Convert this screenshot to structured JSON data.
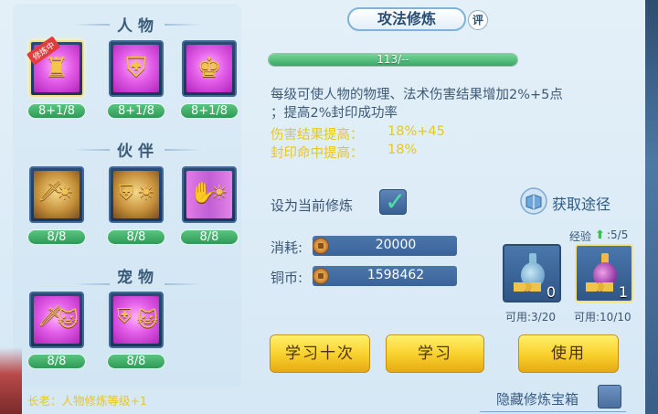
{
  "panel": {
    "tab_title": "攻法修炼",
    "review_badge": "评"
  },
  "sections": {
    "character": {
      "title": "人物",
      "slots": [
        {
          "icon": "golden-armor-icon",
          "level": "8+1/8",
          "badge": "修炼中",
          "active": true
        },
        {
          "icon": "golden-shield-armor-icon",
          "level": "8+1/8",
          "active": false
        },
        {
          "icon": "golden-warrior-armor-icon",
          "level": "8+1/8",
          "active": false
        }
      ]
    },
    "partner": {
      "title": "伙伴",
      "slots": [
        {
          "icon": "lion-sword-icon",
          "level": "8/8"
        },
        {
          "icon": "lion-shield-icon",
          "level": "8/8"
        },
        {
          "icon": "lion-claw-icon",
          "level": "8/8"
        }
      ]
    },
    "pet": {
      "title": "宠物",
      "slots": [
        {
          "icon": "lion-cub-sword-icon",
          "level": "8/8"
        },
        {
          "icon": "lion-cub-shield-icon",
          "level": "8/8"
        }
      ]
    }
  },
  "progress": {
    "text": "113/--",
    "fill_fraction": 1.0
  },
  "description": {
    "line1": "每级可使人物的物理、法术伤害结果增加2%+5点",
    "line2": "；提高2%封印成功率"
  },
  "bonuses": [
    {
      "label": "伤害结果提高：",
      "value": "18%+45"
    },
    {
      "label": "封印命中提高：",
      "value": "18%"
    }
  ],
  "set_current": {
    "label": "设为当前修炼",
    "checked": true
  },
  "obtain": {
    "label": "获取途径"
  },
  "costs": {
    "consume_label": "消耗:",
    "consume_value": "20000",
    "coin_label": "铜币:",
    "coin_value": "1598462"
  },
  "experience": {
    "label": "经验",
    "value": ":5/5"
  },
  "items": [
    {
      "icon": "blue-potion-icon",
      "count": "0",
      "usable": "可用:3/20",
      "selected": false
    },
    {
      "icon": "purple-potion-icon",
      "count": "1",
      "usable": "可用:10/10",
      "selected": true
    }
  ],
  "buttons": {
    "learn_ten": "学习十次",
    "learn": "学习",
    "use": "使用"
  },
  "hint": "长老：人物修炼等级+1",
  "hidden_chest": {
    "label": "隐藏修炼宝箱",
    "checked": false
  },
  "colors": {
    "accent_yellow": "#e8c71e",
    "progress_green": "#39a866",
    "button_gold": "#f8cf2a",
    "panel_blue": "#d6e8f5"
  }
}
